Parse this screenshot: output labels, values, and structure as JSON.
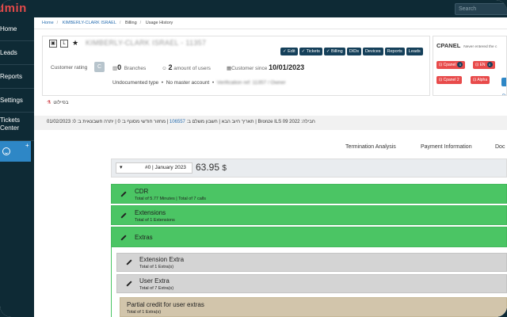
{
  "app": {
    "brand": "dmin",
    "search_placeholder": "Search"
  },
  "sidebar": {
    "items": [
      {
        "label": "Home"
      },
      {
        "label": "Leads"
      },
      {
        "label": "Reports"
      },
      {
        "label": "Settings"
      },
      {
        "label1": "Tickets",
        "label2": "Center"
      }
    ],
    "plus": "+"
  },
  "breadcrumb": [
    "Home",
    "KIMBERLY-CLARK ISRAEL",
    "Billing",
    "Usage History"
  ],
  "account": {
    "name": "KIMBERLY-CLARK ISRAEL - 11357",
    "actions": [
      "Edit",
      "Tickets",
      "Billing",
      "DIDs",
      "Devices",
      "Reports",
      "Leads"
    ],
    "rating_label": "Customer rating",
    "rating_value": "C",
    "branches_count": "0",
    "branches_label": "Branches",
    "users_count": "2",
    "users_label": "amount of users",
    "customer_since_label": "Customer since",
    "customer_since_value": "10/01/2023",
    "undocumented": "Undocumented type",
    "master": "No master account",
    "blurred_text": "Verification ref: 11357 / Owner"
  },
  "cpanel": {
    "title": "CPANEL",
    "note": "Never entered the c",
    "buttons": [
      {
        "label": "Cpanel",
        "badge": "0"
      },
      {
        "label": "EN",
        "badge": "0"
      },
      {
        "label": "Cpanel 2"
      },
      {
        "label": "Alpha"
      }
    ],
    "link": "Pa"
  },
  "flag_text": "בפיילוט",
  "info_bar": {
    "prefix": "01/02/2023 :תאריך חיוב הבא | חשבון משלם ב: ",
    "account_link": "106557",
    "suffix": " | מחזור חודשי מסונף ב: 0 | יתרה חשבונאית ב: 0 | Bronze ILS 09 2022 :חבילה"
  },
  "tabs": [
    "Termination Analysis",
    "Payment Information",
    "Doc"
  ],
  "period": {
    "selected": "#0 | January 2023",
    "amount": "63.95",
    "currency": "$"
  },
  "groups": [
    {
      "title": "CDR",
      "sub": "Total of 5.77 Minutes | Total of 7 calls"
    },
    {
      "title": "Extensions",
      "sub": "Total of 1 Extensions"
    },
    {
      "title": "Extras",
      "sub": ""
    }
  ],
  "extras": [
    {
      "title": "Extension Extra",
      "sub": "Total of 1 Extra(s)"
    },
    {
      "title": "User Extra",
      "sub": "Total of 7 Extra(s)"
    },
    {
      "title": "Partial credit for user extras",
      "sub": "Total of 1 Extra(s)"
    }
  ],
  "colors": {
    "green": "#4bc564",
    "navy": "#0e2a35",
    "accent_blue": "#2e87c6",
    "red": "#e84b4b",
    "tan": "#d2c5ab"
  }
}
